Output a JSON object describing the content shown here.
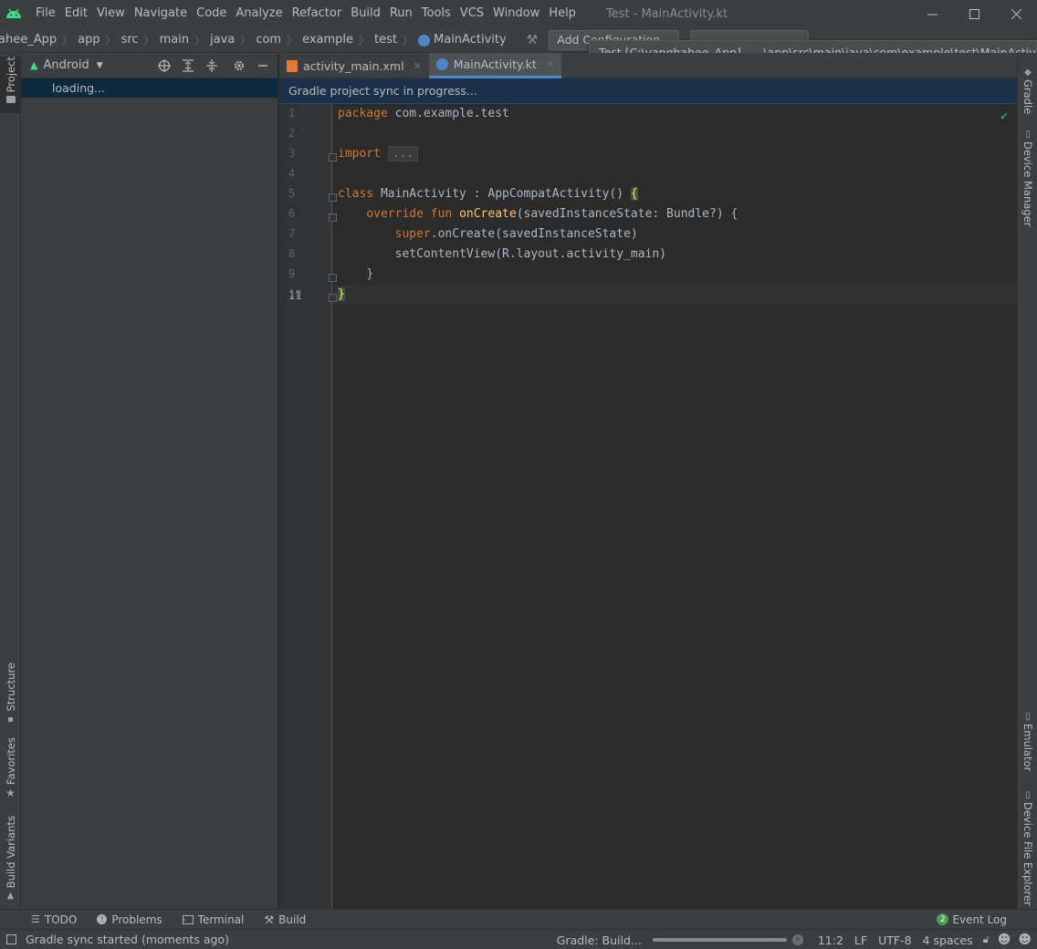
{
  "menu": {
    "items": [
      "File",
      "Edit",
      "View",
      "Navigate",
      "Code",
      "Analyze",
      "Refactor",
      "Build",
      "Run",
      "Tools",
      "VCS",
      "Window",
      "Help"
    ],
    "window_title": "Test - MainActivity.kt"
  },
  "breadcrumbs": [
    "ahee_App",
    "app",
    "src",
    "main",
    "java",
    "com",
    "example",
    "test",
    "MainActivity"
  ],
  "toolbar": {
    "add_config_label": "Add Configuration..."
  },
  "tooltip": {
    "text": "Test [C:\\yanghahee_App] - ...\\app\\src\\main\\java\\com\\example\\test\\MainActivity.kt"
  },
  "left_strip": {
    "project": "Project",
    "structure": "Structure",
    "favorites": "Favorites",
    "build_variants": "Build Variants"
  },
  "project_panel": {
    "view_mode": "Android",
    "loading_text": "loading..."
  },
  "editor": {
    "tabs": [
      {
        "label": "activity_main.xml",
        "active": false
      },
      {
        "label": "MainActivity.kt",
        "active": true
      }
    ],
    "sync_banner": "Gradle project sync in progress...",
    "line_numbers": [
      "1",
      "2",
      "3",
      "4",
      "5",
      "6",
      "7",
      "8",
      "9",
      "10",
      "11"
    ],
    "current_line": 11,
    "code": {
      "l1_kw": "package",
      "l1_rest": " com.example.test",
      "l3_kw": "import",
      "l3_collapsed": "...",
      "l6_kw": "class",
      "l6_rest": " MainActivity : AppCompatActivity() ",
      "l6_brace": "{",
      "l7_kw": "override fun ",
      "l7_fn": "onCreate",
      "l7_rest": "(savedInstanceState: Bundle?) {",
      "l8_kw": "super",
      "l8_rest": ".onCreate(savedInstanceState)",
      "l9_rest": "setContentView(R.layout.activity_main)",
      "l10_rest": "}",
      "l11_brace": "}"
    }
  },
  "right_strip": {
    "gradle": "Gradle",
    "device_manager": "Device Manager",
    "emulator": "Emulator",
    "device_file_explorer": "Device File Explorer"
  },
  "bottom_tools": {
    "todo": "TODO",
    "problems": "Problems",
    "terminal": "Terminal",
    "build": "Build",
    "event_log": "Event Log",
    "event_count": "2"
  },
  "status": {
    "message": "Gradle sync started (moments ago)",
    "gradle_task": "Gradle: Build...",
    "caret": "11:2",
    "line_sep": "LF",
    "encoding": "UTF-8",
    "indent": "4 spaces"
  },
  "colors": {
    "accent": "#4a88c7",
    "android_green": "#3ddc84",
    "ok_green": "#499c54"
  }
}
